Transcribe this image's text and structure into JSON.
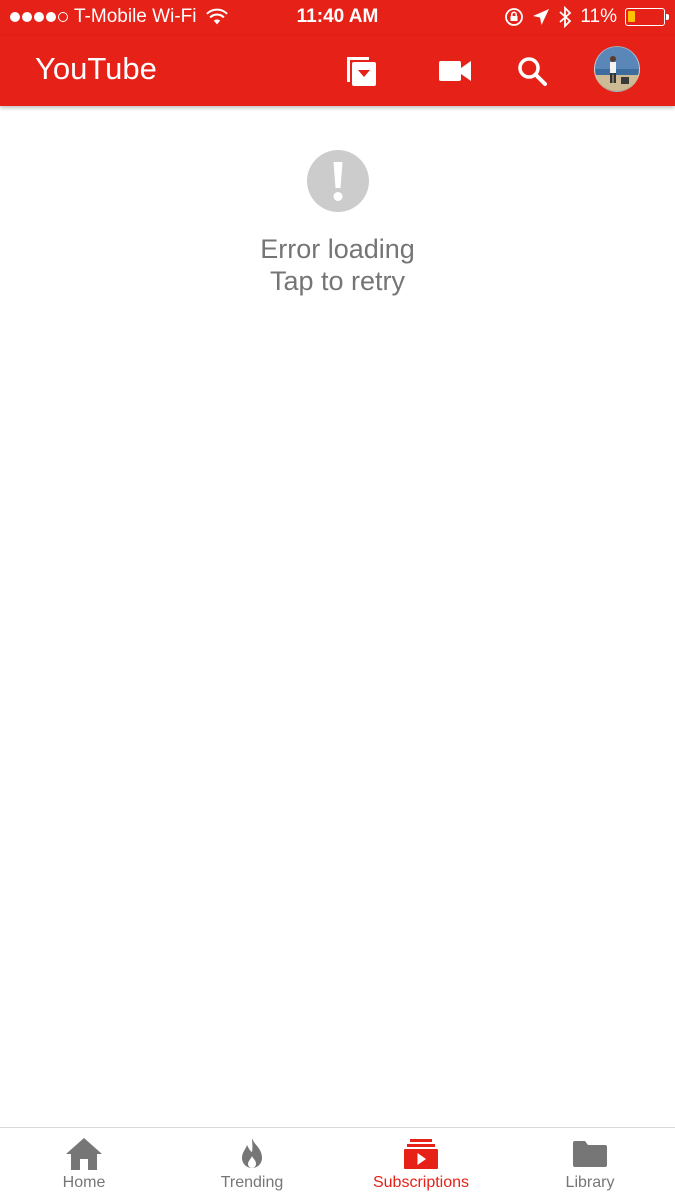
{
  "status_bar": {
    "carrier": "T-Mobile Wi-Fi",
    "time": "11:40 AM",
    "battery_percent": "11%",
    "battery_level": 0.11
  },
  "app_bar": {
    "title": "YouTube",
    "brand_color": "#e62117"
  },
  "icons": {
    "cast": "cast-icon",
    "camera": "video-camera-icon",
    "search": "search-icon",
    "avatar": "avatar"
  },
  "error": {
    "line1": "Error loading",
    "line2": "Tap to retry"
  },
  "bottom_nav": {
    "active_color": "#e62117",
    "inactive_color": "#767676",
    "items": [
      {
        "label": "Home",
        "icon": "home-icon",
        "active": false
      },
      {
        "label": "Trending",
        "icon": "flame-icon",
        "active": false
      },
      {
        "label": "Subscriptions",
        "icon": "subscriptions-icon",
        "active": true
      },
      {
        "label": "Library",
        "icon": "folder-icon",
        "active": false
      }
    ]
  }
}
